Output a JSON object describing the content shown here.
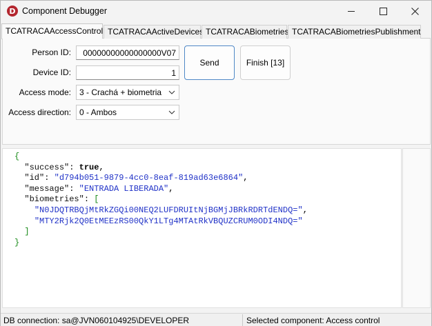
{
  "window": {
    "title": "Component Debugger",
    "icon_letter": "D",
    "icon_color": "#b3262e"
  },
  "tabs": [
    {
      "label": "TCATRACAAccessControl",
      "active": true
    },
    {
      "label": "TCATRACAActiveDevices",
      "active": false
    },
    {
      "label": "TCATRACABiometries",
      "active": false
    },
    {
      "label": "TCATRACABiometriesPublishment",
      "active": false
    }
  ],
  "form": {
    "person_id_label": "Person ID:",
    "person_id_value": "00000000000000000V07",
    "device_id_label": "Device ID:",
    "device_id_value": "1",
    "access_mode_label": "Access mode:",
    "access_mode_value": "3 - Crachá + biometria",
    "access_direction_label": "Access direction:",
    "access_direction_value": "0 - Ambos",
    "send_label": "Send",
    "finish_label": "Finish [13]"
  },
  "output": {
    "open_brace": "{",
    "success_key": "\"success\"",
    "success_value": "true",
    "id_key": "\"id\"",
    "id_value": "\"d794b051-9879-4cc0-8eaf-819ad63e6864\"",
    "message_key": "\"message\"",
    "message_value": "\"ENTRADA LIBERADA\"",
    "biometries_key": "\"biometries\"",
    "biometries": [
      "\"N0JDQTRBQjMtRkZGQi00NEQ2LUFDRUItNjBGMjJBRkRDRTdENDQ=\"",
      "\"MTY2Rjk2Q0EtMEEzRS00QkY1LTg4MTAtRkVBQUZCRUM0ODI4NDQ=\""
    ],
    "close_bracket": "]",
    "close_brace": "}"
  },
  "status": {
    "db_connection": "DB connection: sa@JVN060104925\\DEVELOPER",
    "selected_component": "Selected component: Access control"
  },
  "colors": {
    "json_punctuation": "#188a18",
    "json_string": "#1f31c7",
    "focus_border": "#4d86c5"
  }
}
